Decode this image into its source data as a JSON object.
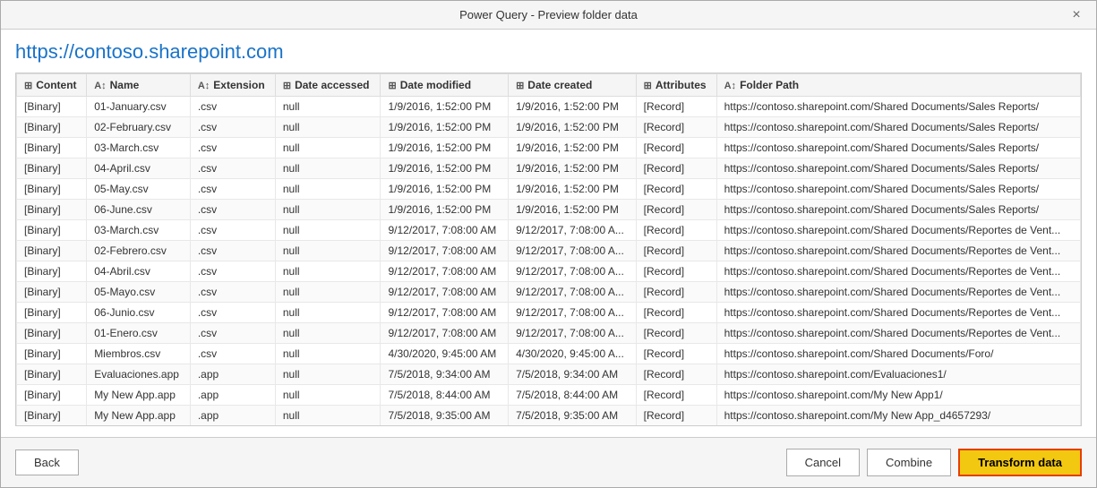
{
  "window": {
    "title": "Power Query - Preview folder data",
    "close_label": "×"
  },
  "url": "https://contoso.sharepoint.com",
  "table": {
    "columns": [
      {
        "icon": "⊞",
        "label": "Content"
      },
      {
        "icon": "A↕",
        "label": "Name"
      },
      {
        "icon": "A↕",
        "label": "Extension"
      },
      {
        "icon": "⊞",
        "label": "Date accessed"
      },
      {
        "icon": "⊞",
        "label": "Date modified"
      },
      {
        "icon": "⊞",
        "label": "Date created"
      },
      {
        "icon": "⊞",
        "label": "Attributes"
      },
      {
        "icon": "A↕",
        "label": "Folder Path"
      }
    ],
    "rows": [
      {
        "content": "[Binary]",
        "name": "01-January.csv",
        "ext": ".csv",
        "accessed": "null",
        "modified": "1/9/2016, 1:52:00 PM",
        "created": "1/9/2016, 1:52:00 PM",
        "attributes": "[Record]",
        "path": "https://contoso.sharepoint.com/Shared Documents/Sales Reports/"
      },
      {
        "content": "[Binary]",
        "name": "02-February.csv",
        "ext": ".csv",
        "accessed": "null",
        "modified": "1/9/2016, 1:52:00 PM",
        "created": "1/9/2016, 1:52:00 PM",
        "attributes": "[Record]",
        "path": "https://contoso.sharepoint.com/Shared Documents/Sales Reports/"
      },
      {
        "content": "[Binary]",
        "name": "03-March.csv",
        "ext": ".csv",
        "accessed": "null",
        "modified": "1/9/2016, 1:52:00 PM",
        "created": "1/9/2016, 1:52:00 PM",
        "attributes": "[Record]",
        "path": "https://contoso.sharepoint.com/Shared Documents/Sales Reports/"
      },
      {
        "content": "[Binary]",
        "name": "04-April.csv",
        "ext": ".csv",
        "accessed": "null",
        "modified": "1/9/2016, 1:52:00 PM",
        "created": "1/9/2016, 1:52:00 PM",
        "attributes": "[Record]",
        "path": "https://contoso.sharepoint.com/Shared Documents/Sales Reports/"
      },
      {
        "content": "[Binary]",
        "name": "05-May.csv",
        "ext": ".csv",
        "accessed": "null",
        "modified": "1/9/2016, 1:52:00 PM",
        "created": "1/9/2016, 1:52:00 PM",
        "attributes": "[Record]",
        "path": "https://contoso.sharepoint.com/Shared Documents/Sales Reports/"
      },
      {
        "content": "[Binary]",
        "name": "06-June.csv",
        "ext": ".csv",
        "accessed": "null",
        "modified": "1/9/2016, 1:52:00 PM",
        "created": "1/9/2016, 1:52:00 PM",
        "attributes": "[Record]",
        "path": "https://contoso.sharepoint.com/Shared Documents/Sales Reports/"
      },
      {
        "content": "[Binary]",
        "name": "03-March.csv",
        "ext": ".csv",
        "accessed": "null",
        "modified": "9/12/2017, 7:08:00 AM",
        "created": "9/12/2017, 7:08:00 A...",
        "attributes": "[Record]",
        "path": "https://contoso.sharepoint.com/Shared Documents/Reportes de Vent..."
      },
      {
        "content": "[Binary]",
        "name": "02-Febrero.csv",
        "ext": ".csv",
        "accessed": "null",
        "modified": "9/12/2017, 7:08:00 AM",
        "created": "9/12/2017, 7:08:00 A...",
        "attributes": "[Record]",
        "path": "https://contoso.sharepoint.com/Shared Documents/Reportes de Vent..."
      },
      {
        "content": "[Binary]",
        "name": "04-Abril.csv",
        "ext": ".csv",
        "accessed": "null",
        "modified": "9/12/2017, 7:08:00 AM",
        "created": "9/12/2017, 7:08:00 A...",
        "attributes": "[Record]",
        "path": "https://contoso.sharepoint.com/Shared Documents/Reportes de Vent..."
      },
      {
        "content": "[Binary]",
        "name": "05-Mayo.csv",
        "ext": ".csv",
        "accessed": "null",
        "modified": "9/12/2017, 7:08:00 AM",
        "created": "9/12/2017, 7:08:00 A...",
        "attributes": "[Record]",
        "path": "https://contoso.sharepoint.com/Shared Documents/Reportes de Vent..."
      },
      {
        "content": "[Binary]",
        "name": "06-Junio.csv",
        "ext": ".csv",
        "accessed": "null",
        "modified": "9/12/2017, 7:08:00 AM",
        "created": "9/12/2017, 7:08:00 A...",
        "attributes": "[Record]",
        "path": "https://contoso.sharepoint.com/Shared Documents/Reportes de Vent..."
      },
      {
        "content": "[Binary]",
        "name": "01-Enero.csv",
        "ext": ".csv",
        "accessed": "null",
        "modified": "9/12/2017, 7:08:00 AM",
        "created": "9/12/2017, 7:08:00 A...",
        "attributes": "[Record]",
        "path": "https://contoso.sharepoint.com/Shared Documents/Reportes de Vent..."
      },
      {
        "content": "[Binary]",
        "name": "Miembros.csv",
        "ext": ".csv",
        "accessed": "null",
        "modified": "4/30/2020, 9:45:00 AM",
        "created": "4/30/2020, 9:45:00 A...",
        "attributes": "[Record]",
        "path": "https://contoso.sharepoint.com/Shared Documents/Foro/"
      },
      {
        "content": "[Binary]",
        "name": "Evaluaciones.app",
        "ext": ".app",
        "accessed": "null",
        "modified": "7/5/2018, 9:34:00 AM",
        "created": "7/5/2018, 9:34:00 AM",
        "attributes": "[Record]",
        "path": "https://contoso.sharepoint.com/Evaluaciones1/"
      },
      {
        "content": "[Binary]",
        "name": "My New App.app",
        "ext": ".app",
        "accessed": "null",
        "modified": "7/5/2018, 8:44:00 AM",
        "created": "7/5/2018, 8:44:00 AM",
        "attributes": "[Record]",
        "path": "https://contoso.sharepoint.com/My New App1/"
      },
      {
        "content": "[Binary]",
        "name": "My New App.app",
        "ext": ".app",
        "accessed": "null",
        "modified": "7/5/2018, 9:35:00 AM",
        "created": "7/5/2018, 9:35:00 AM",
        "attributes": "[Record]",
        "path": "https://contoso.sharepoint.com/My New App_d4657293/"
      }
    ]
  },
  "footer": {
    "back_label": "Back",
    "cancel_label": "Cancel",
    "combine_label": "Combine",
    "transform_label": "Transform data"
  }
}
